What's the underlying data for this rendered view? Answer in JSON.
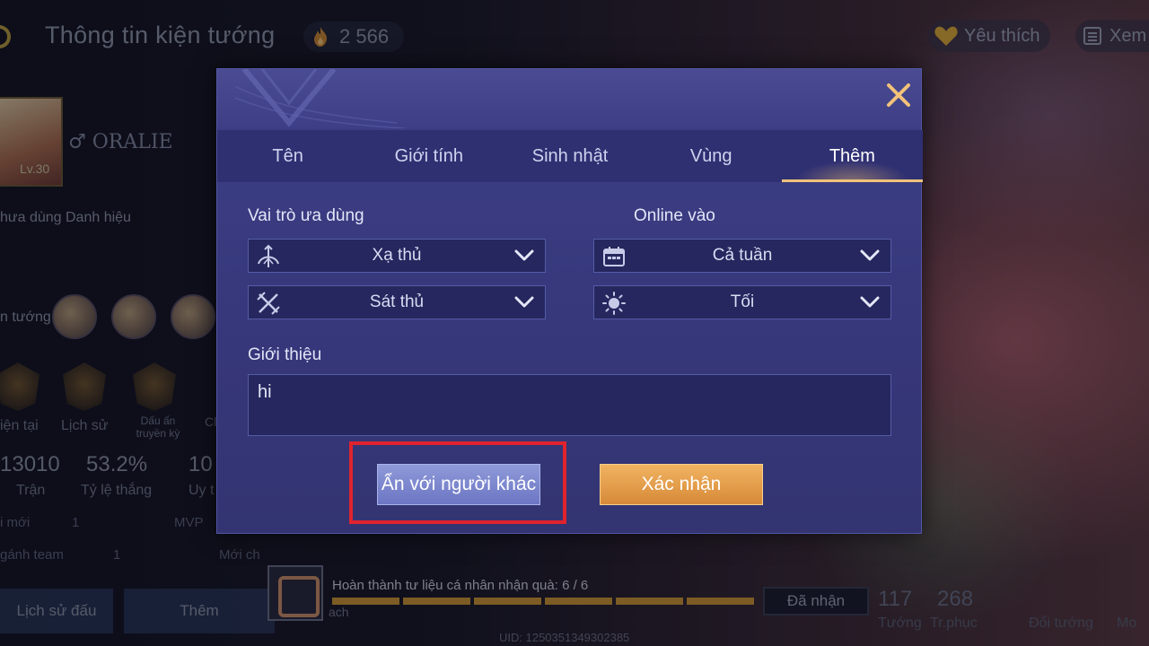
{
  "background": {
    "header_title": "Thông tin kiện tướng",
    "currency_value": "2 566",
    "favorite_label": "Yêu thích",
    "view_label": "Xem",
    "player_name": "♂ ORALIE",
    "level": "Lv.30",
    "title_text": "hưa dùng Danh hiệu",
    "heroes_label": "n tướng",
    "stats": {
      "label_current": "iện tại",
      "label_history": "Lịch sử",
      "label_legend": "Dấu ấn truyền kỳ",
      "label_ci": "Cl",
      "matches": "13010",
      "matches_label": "Trận",
      "winrate": "53.2%",
      "winrate_label": "Tỷ lệ thắng",
      "rep": "10",
      "rep_label": "Uy t"
    },
    "side_rows": [
      "i mới",
      "1",
      "MVP",
      "gánh team",
      "1",
      "Mới ch"
    ],
    "bottom_tabs": [
      "Lịch sử đấu",
      "Thêm"
    ],
    "mission_text": "Hoàn thành tư liệu cá nhân nhận quà: 6 / 6",
    "claimed_label": "Đã nhận",
    "heroes_count": "117",
    "heroes_count_label": "Tướng",
    "skins_count": "268",
    "skins_count_label": "Tr.phục",
    "swap_label": "Đổi tướng",
    "more_label": "Mo",
    "ach_label": "ach",
    "uid": "UID: 1250351349302385"
  },
  "modal": {
    "tabs": [
      {
        "label": "Tên",
        "active": false
      },
      {
        "label": "Giới tính",
        "active": false
      },
      {
        "label": "Sinh nhật",
        "active": false
      },
      {
        "label": "Vùng",
        "active": false
      },
      {
        "label": "Thêm",
        "active": true
      }
    ],
    "role_label": "Vai trò ưa dùng",
    "online_label": "Online vào",
    "role_primary": {
      "value": "Xạ thủ",
      "icon": "archer-icon"
    },
    "role_secondary": {
      "value": "Sát thủ",
      "icon": "assassin-icon"
    },
    "online_days": {
      "value": "Cả tuần",
      "icon": "calendar-icon"
    },
    "online_time": {
      "value": "Tối",
      "icon": "sun-icon"
    },
    "bio_label": "Giới thiệu",
    "bio_value": "hi",
    "hide_button": "Ẩn với người khác",
    "confirm_button": "Xác nhận"
  },
  "colors": {
    "accent_gold": "#f0c27a",
    "highlight_red": "#e0232d",
    "modal_bg": "#3e3f86"
  }
}
